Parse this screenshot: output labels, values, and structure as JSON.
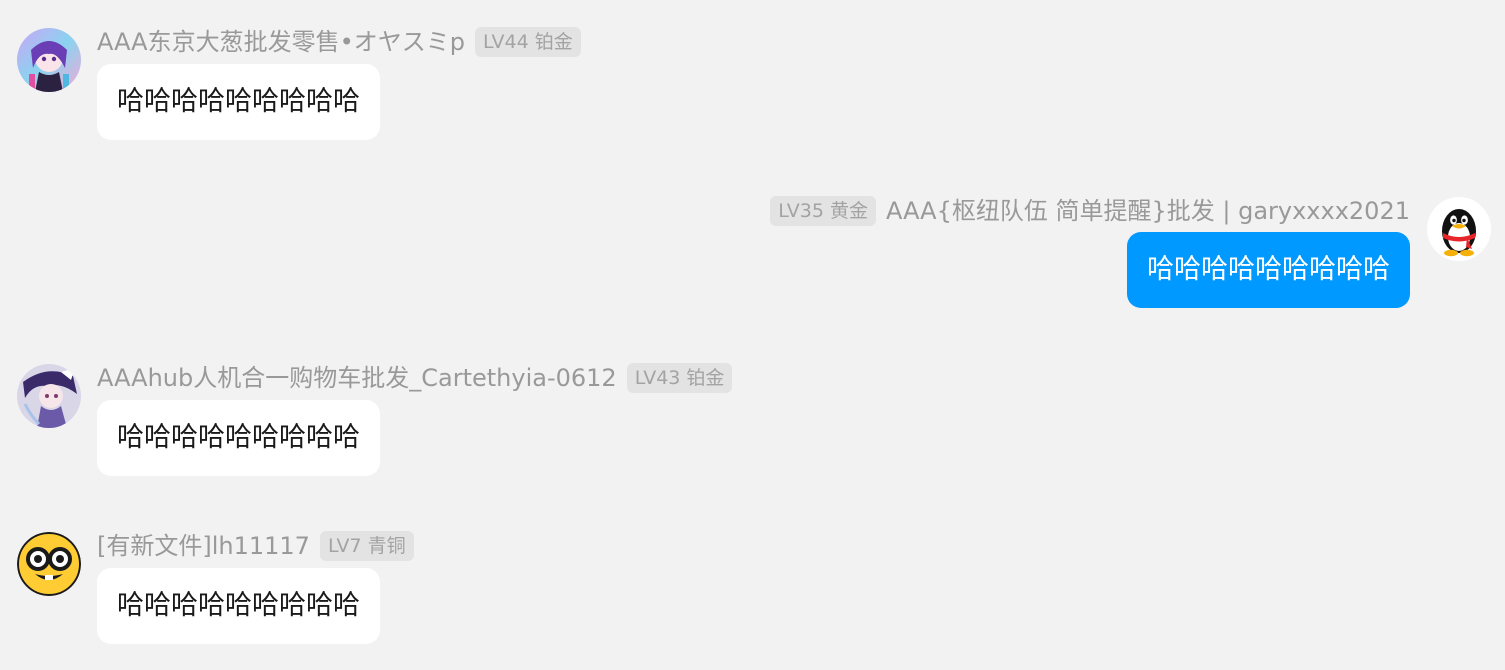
{
  "messages": [
    {
      "side": "left",
      "avatar_icon": "anime-girl-avatar",
      "sender": "AAA东京大葱批发零售•オヤスミp",
      "level": "LV44 铂金",
      "text": "哈哈哈哈哈哈哈哈哈"
    },
    {
      "side": "right",
      "avatar_icon": "qq-penguin-avatar",
      "sender": "AAA{枢纽队伍 简单提醒}批发 | garyxxxx2021",
      "level": "LV35 黄金",
      "text": "哈哈哈哈哈哈哈哈哈"
    },
    {
      "side": "left",
      "avatar_icon": "anime-character-avatar",
      "sender": "AAAhub人机合一购物车批发_Cartethyia-0612",
      "level": "LV43 铂金",
      "text": "哈哈哈哈哈哈哈哈哈"
    },
    {
      "side": "left",
      "avatar_icon": "nerd-emoji-avatar",
      "sender": "[有新文件]lh11117",
      "level": "LV7 青铜",
      "text": "哈哈哈哈哈哈哈哈哈"
    }
  ],
  "colors": {
    "background": "#f2f2f2",
    "self_bubble": "#0099ff",
    "other_bubble": "#ffffff"
  }
}
